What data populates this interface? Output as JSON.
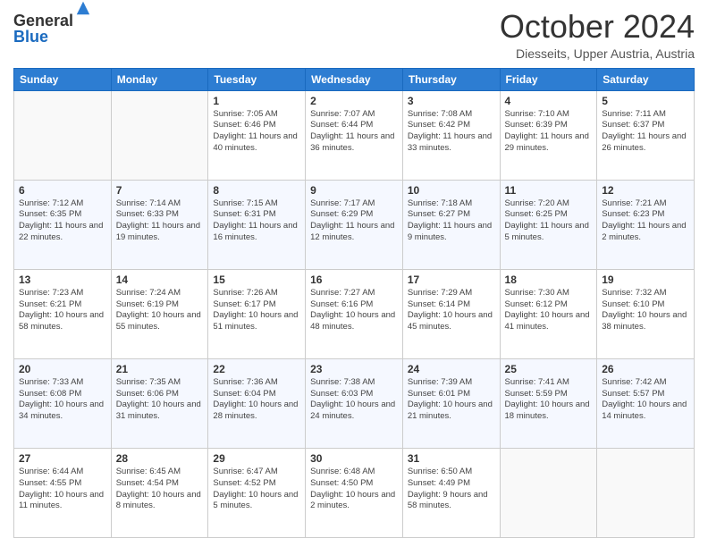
{
  "logo": {
    "general": "General",
    "blue": "Blue"
  },
  "header": {
    "month": "October 2024",
    "location": "Diesseits, Upper Austria, Austria"
  },
  "weekdays": [
    "Sunday",
    "Monday",
    "Tuesday",
    "Wednesday",
    "Thursday",
    "Friday",
    "Saturday"
  ],
  "weeks": [
    [
      {
        "day": "",
        "info": ""
      },
      {
        "day": "",
        "info": ""
      },
      {
        "day": "1",
        "info": "Sunrise: 7:05 AM\nSunset: 6:46 PM\nDaylight: 11 hours and 40 minutes."
      },
      {
        "day": "2",
        "info": "Sunrise: 7:07 AM\nSunset: 6:44 PM\nDaylight: 11 hours and 36 minutes."
      },
      {
        "day": "3",
        "info": "Sunrise: 7:08 AM\nSunset: 6:42 PM\nDaylight: 11 hours and 33 minutes."
      },
      {
        "day": "4",
        "info": "Sunrise: 7:10 AM\nSunset: 6:39 PM\nDaylight: 11 hours and 29 minutes."
      },
      {
        "day": "5",
        "info": "Sunrise: 7:11 AM\nSunset: 6:37 PM\nDaylight: 11 hours and 26 minutes."
      }
    ],
    [
      {
        "day": "6",
        "info": "Sunrise: 7:12 AM\nSunset: 6:35 PM\nDaylight: 11 hours and 22 minutes."
      },
      {
        "day": "7",
        "info": "Sunrise: 7:14 AM\nSunset: 6:33 PM\nDaylight: 11 hours and 19 minutes."
      },
      {
        "day": "8",
        "info": "Sunrise: 7:15 AM\nSunset: 6:31 PM\nDaylight: 11 hours and 16 minutes."
      },
      {
        "day": "9",
        "info": "Sunrise: 7:17 AM\nSunset: 6:29 PM\nDaylight: 11 hours and 12 minutes."
      },
      {
        "day": "10",
        "info": "Sunrise: 7:18 AM\nSunset: 6:27 PM\nDaylight: 11 hours and 9 minutes."
      },
      {
        "day": "11",
        "info": "Sunrise: 7:20 AM\nSunset: 6:25 PM\nDaylight: 11 hours and 5 minutes."
      },
      {
        "day": "12",
        "info": "Sunrise: 7:21 AM\nSunset: 6:23 PM\nDaylight: 11 hours and 2 minutes."
      }
    ],
    [
      {
        "day": "13",
        "info": "Sunrise: 7:23 AM\nSunset: 6:21 PM\nDaylight: 10 hours and 58 minutes."
      },
      {
        "day": "14",
        "info": "Sunrise: 7:24 AM\nSunset: 6:19 PM\nDaylight: 10 hours and 55 minutes."
      },
      {
        "day": "15",
        "info": "Sunrise: 7:26 AM\nSunset: 6:17 PM\nDaylight: 10 hours and 51 minutes."
      },
      {
        "day": "16",
        "info": "Sunrise: 7:27 AM\nSunset: 6:16 PM\nDaylight: 10 hours and 48 minutes."
      },
      {
        "day": "17",
        "info": "Sunrise: 7:29 AM\nSunset: 6:14 PM\nDaylight: 10 hours and 45 minutes."
      },
      {
        "day": "18",
        "info": "Sunrise: 7:30 AM\nSunset: 6:12 PM\nDaylight: 10 hours and 41 minutes."
      },
      {
        "day": "19",
        "info": "Sunrise: 7:32 AM\nSunset: 6:10 PM\nDaylight: 10 hours and 38 minutes."
      }
    ],
    [
      {
        "day": "20",
        "info": "Sunrise: 7:33 AM\nSunset: 6:08 PM\nDaylight: 10 hours and 34 minutes."
      },
      {
        "day": "21",
        "info": "Sunrise: 7:35 AM\nSunset: 6:06 PM\nDaylight: 10 hours and 31 minutes."
      },
      {
        "day": "22",
        "info": "Sunrise: 7:36 AM\nSunset: 6:04 PM\nDaylight: 10 hours and 28 minutes."
      },
      {
        "day": "23",
        "info": "Sunrise: 7:38 AM\nSunset: 6:03 PM\nDaylight: 10 hours and 24 minutes."
      },
      {
        "day": "24",
        "info": "Sunrise: 7:39 AM\nSunset: 6:01 PM\nDaylight: 10 hours and 21 minutes."
      },
      {
        "day": "25",
        "info": "Sunrise: 7:41 AM\nSunset: 5:59 PM\nDaylight: 10 hours and 18 minutes."
      },
      {
        "day": "26",
        "info": "Sunrise: 7:42 AM\nSunset: 5:57 PM\nDaylight: 10 hours and 14 minutes."
      }
    ],
    [
      {
        "day": "27",
        "info": "Sunrise: 6:44 AM\nSunset: 4:55 PM\nDaylight: 10 hours and 11 minutes."
      },
      {
        "day": "28",
        "info": "Sunrise: 6:45 AM\nSunset: 4:54 PM\nDaylight: 10 hours and 8 minutes."
      },
      {
        "day": "29",
        "info": "Sunrise: 6:47 AM\nSunset: 4:52 PM\nDaylight: 10 hours and 5 minutes."
      },
      {
        "day": "30",
        "info": "Sunrise: 6:48 AM\nSunset: 4:50 PM\nDaylight: 10 hours and 2 minutes."
      },
      {
        "day": "31",
        "info": "Sunrise: 6:50 AM\nSunset: 4:49 PM\nDaylight: 9 hours and 58 minutes."
      },
      {
        "day": "",
        "info": ""
      },
      {
        "day": "",
        "info": ""
      }
    ]
  ]
}
